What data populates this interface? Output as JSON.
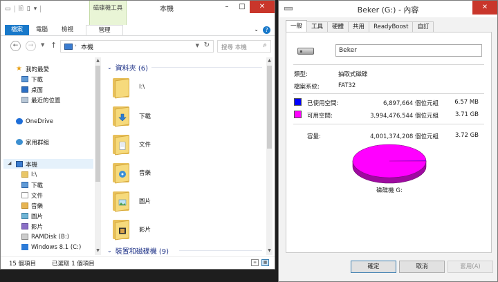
{
  "explorer": {
    "title": "本機",
    "context_tool_label": "磁碟機工具",
    "tabs": {
      "file": "檔案",
      "computer": "電腦",
      "view": "檢視",
      "manage": "管理"
    },
    "address": "本機",
    "search_placeholder": "搜尋 本機",
    "nav": {
      "favorites": "我的最愛",
      "fav_items": [
        "下載",
        "桌面",
        "最近的位置"
      ],
      "onedrive": "OneDrive",
      "homegroup": "家用群組",
      "thispc": "本機",
      "pc_items": [
        "I:\\",
        "下載",
        "文件",
        "音樂",
        "圖片",
        "影片",
        "RAMDisk (B:)",
        "Windows 8.1 (C:)"
      ]
    },
    "groups": {
      "folders": "資料夾 (6)",
      "devices": "裝置和磁碟機 (9)"
    },
    "folders": [
      "I:\\",
      "下載",
      "文件",
      "音樂",
      "圖片",
      "影片"
    ],
    "status": {
      "count": "15 個項目",
      "selected": "已選取 1 個項目"
    }
  },
  "props": {
    "title": "Beker (G:) - 內容",
    "tabs": [
      "一般",
      "工具",
      "硬體",
      "共用",
      "ReadyBoost",
      "自訂"
    ],
    "name": "Beker",
    "type_label": "類型:",
    "type_value": "抽取式磁碟",
    "fs_label": "檔案系統:",
    "fs_value": "FAT32",
    "used_label": "已使用空間:",
    "used_bytes": "6,897,664 個位元組",
    "used_size": "6.57 MB",
    "free_label": "可用空間:",
    "free_bytes": "3,994,476,544 個位元組",
    "free_size": "3.71 GB",
    "cap_label": "容量:",
    "cap_bytes": "4,001,374,208 個位元組",
    "cap_size": "3.72 GB",
    "used_fraction": 0.0017,
    "drive_label": "磁碟機 G:",
    "buttons": {
      "ok": "確定",
      "cancel": "取消",
      "apply": "套用(A)"
    },
    "colors": {
      "used": "#0000ff",
      "free": "#ff00ff",
      "free_side": "#9e0aa0"
    }
  }
}
